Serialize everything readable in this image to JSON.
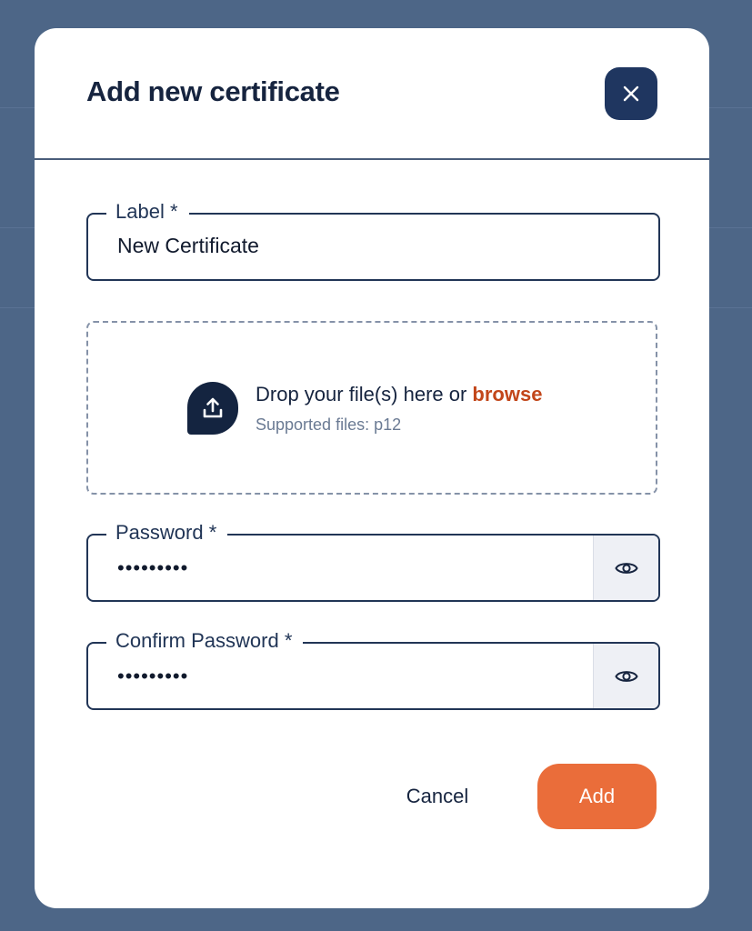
{
  "modal": {
    "title": "Add new certificate",
    "close_icon": "close-icon"
  },
  "form": {
    "label_field": {
      "label": "Label *",
      "value": "New Certificate"
    },
    "dropzone": {
      "icon": "upload-icon",
      "prompt": "Drop your file(s) here or ",
      "browse_label": "browse",
      "hint": "Supported files: p12"
    },
    "password_field": {
      "label": "Password *",
      "value": "•••••••••",
      "toggle_icon": "eye-icon"
    },
    "confirm_password_field": {
      "label": "Confirm Password *",
      "value": "•••••••••",
      "toggle_icon": "eye-icon"
    }
  },
  "actions": {
    "cancel_label": "Cancel",
    "add_label": "Add"
  },
  "colors": {
    "backdrop": "#4d6687",
    "primary_navy": "#1f3660",
    "accent_orange": "#ea6d3a",
    "link_orange": "#c2461a"
  }
}
